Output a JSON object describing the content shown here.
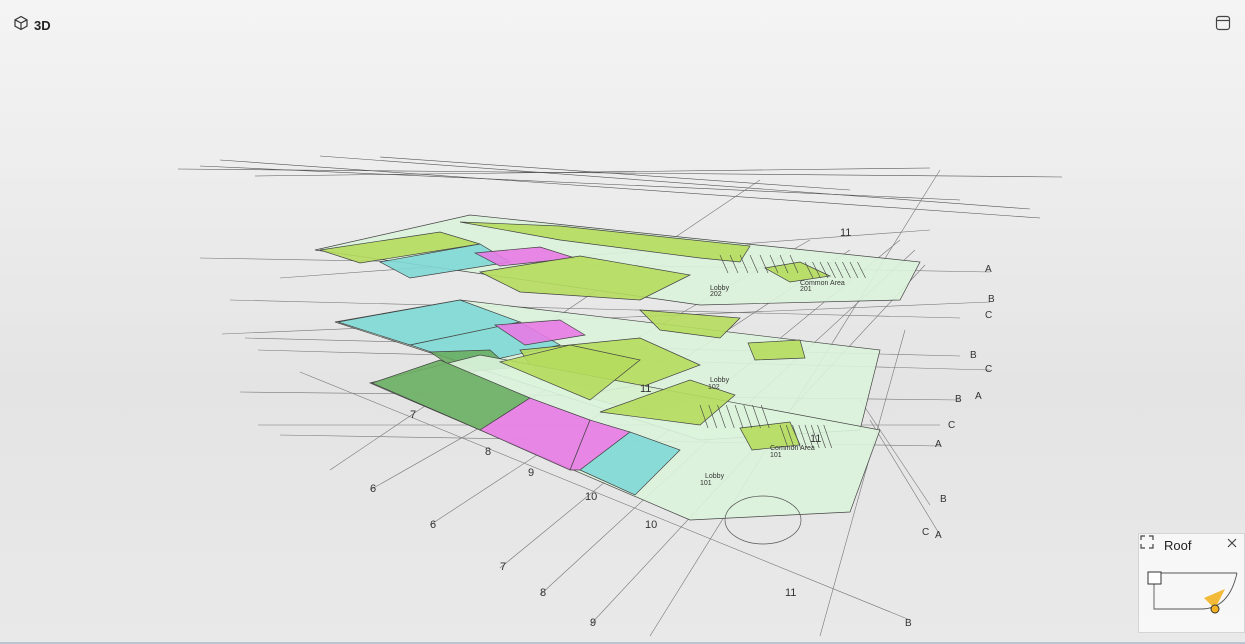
{
  "header": {
    "title": "3D",
    "view_icon": "cube-3d-icon",
    "layout_icon": "layout-panel-icon"
  },
  "model": {
    "labels": [
      "Lobby",
      "101",
      "Lobby",
      "102",
      "Lobby",
      "202",
      "Common Area",
      "101",
      "Common Area",
      "201"
    ],
    "grid_numbers": [
      "6",
      "7",
      "8",
      "9",
      "10",
      "11",
      "6",
      "7",
      "8",
      "9",
      "10",
      "11",
      "11",
      "11"
    ],
    "grid_letters": [
      "B",
      "A",
      "C",
      "B",
      "A",
      "C",
      "B",
      "A",
      "C",
      "B",
      "A",
      "C",
      "B"
    ]
  },
  "minimap": {
    "title": "Roof",
    "expand_icon": "expand-icon",
    "close_icon": "close-icon"
  },
  "colors": {
    "lime": "#b5dc5d",
    "mint": "#dcf3dc",
    "cyan": "#7fd8d6",
    "magenta": "#e87ae6",
    "green": "#6aae63",
    "line": "#555555",
    "camera": "#f2b222"
  }
}
